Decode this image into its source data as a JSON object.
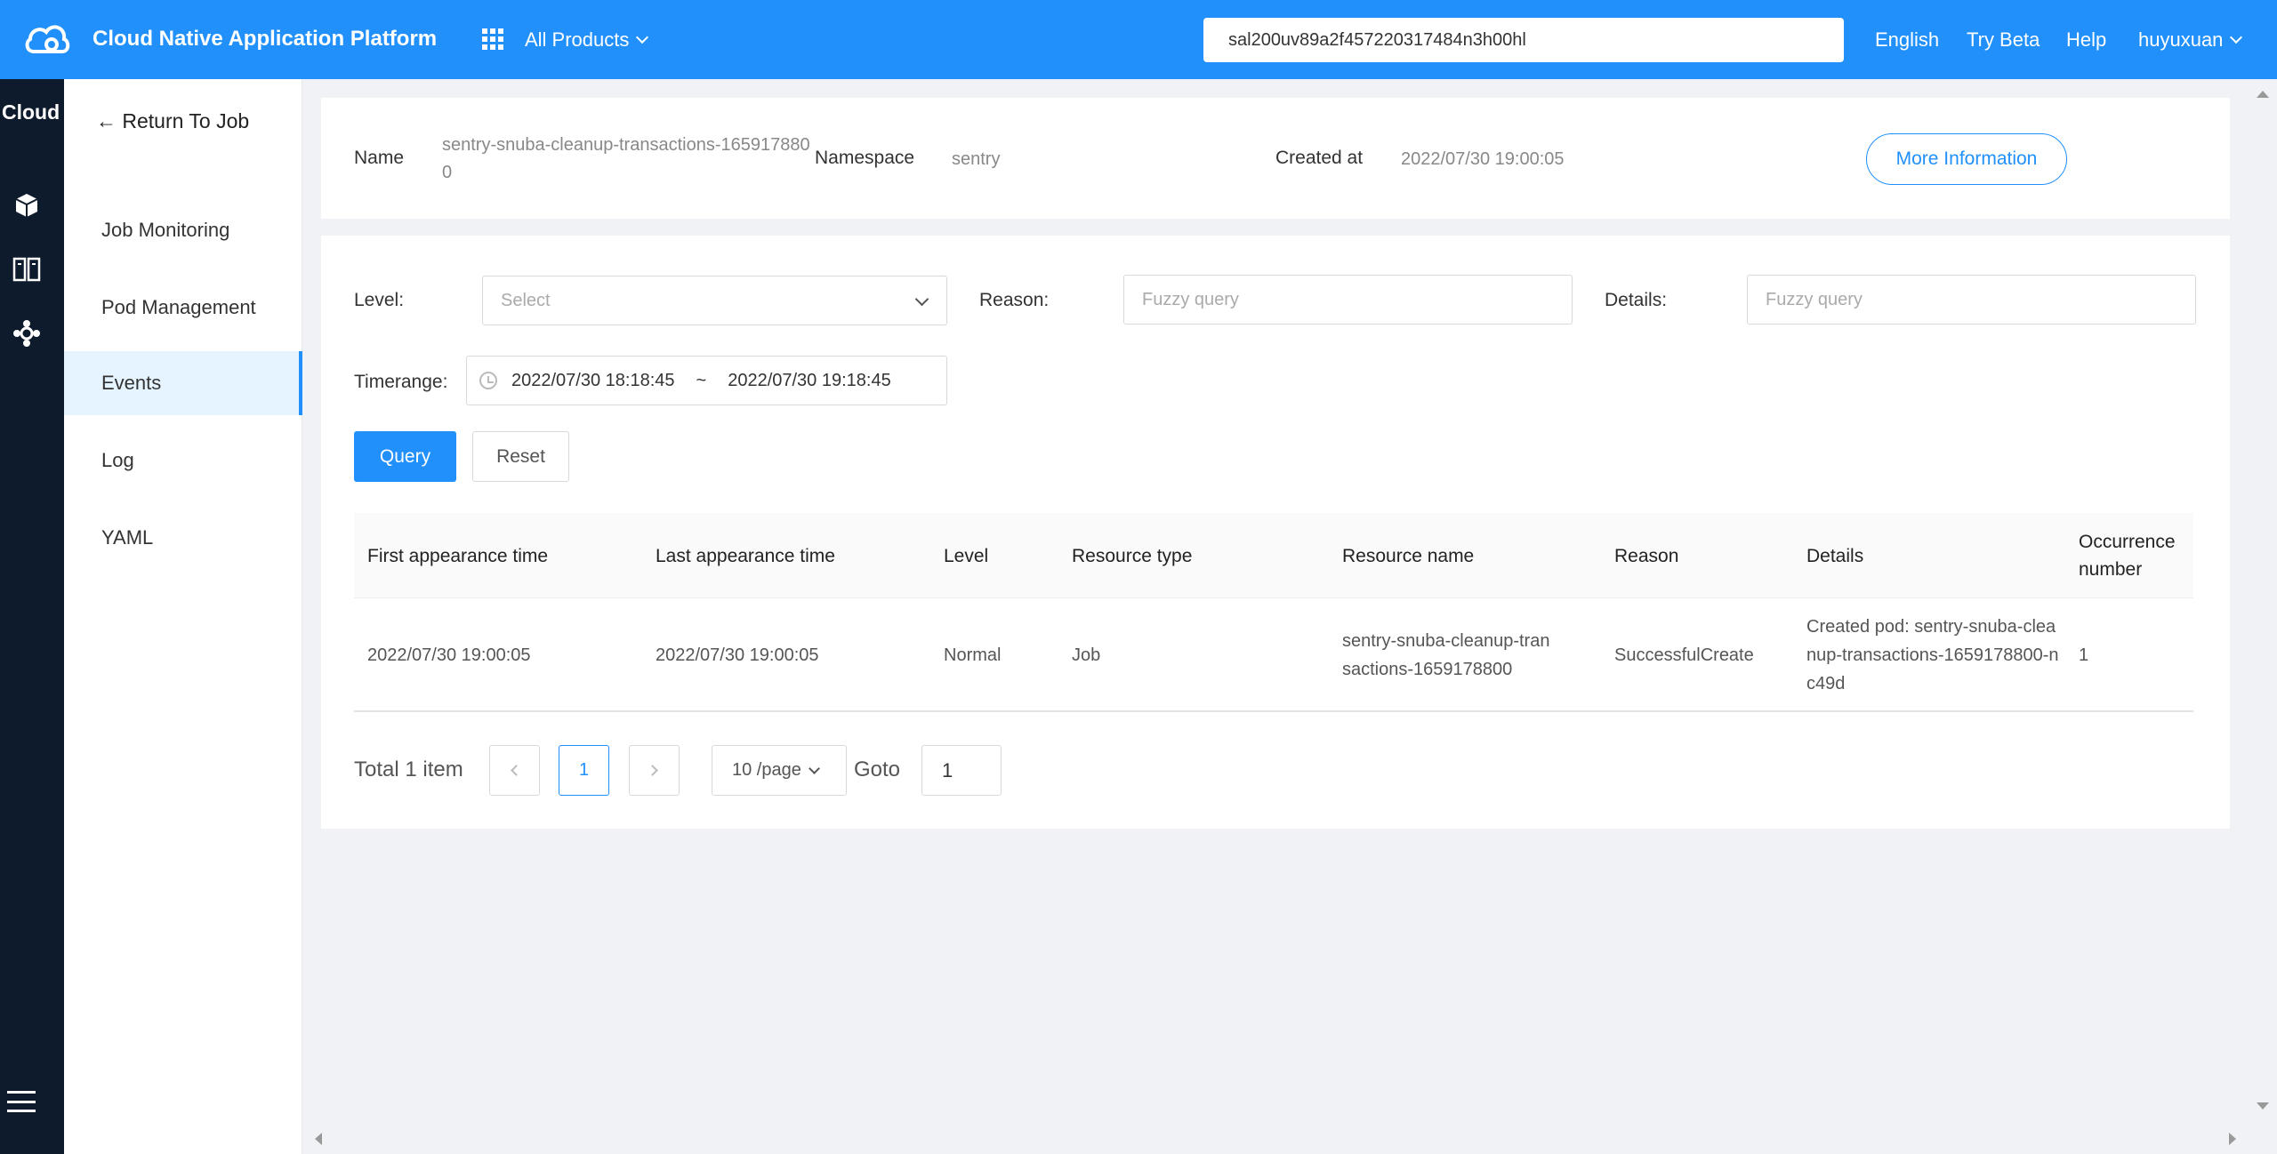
{
  "header": {
    "app_title": "Cloud Native Application Platform",
    "all_products": "All Products",
    "search_value": "sal200uv89a2f457220317484n3h00hl",
    "links": {
      "english": "English",
      "try_beta": "Try Beta",
      "help": "Help",
      "user": "huyuxuan"
    },
    "accent_color": "#2190fb"
  },
  "rail": {
    "title": "Cloud",
    "icons": [
      "cube-icon",
      "columns-icon",
      "network-icon",
      "menu-icon"
    ]
  },
  "subnav": {
    "back": "← Return To Job",
    "items": [
      {
        "label": "Job Monitoring"
      },
      {
        "label": "Pod Management"
      },
      {
        "label": "Events",
        "active": true
      },
      {
        "label": "Log"
      },
      {
        "label": "YAML"
      }
    ]
  },
  "info": {
    "name_label": "Name",
    "name_value": "sentry-snuba-cleanup-transactions-1659178800",
    "namespace_label": "Namespace",
    "namespace_value": "sentry",
    "created_label": "Created at",
    "created_value": "2022/07/30 19:00:05",
    "more_button": "More Information"
  },
  "filters": {
    "level_label": "Level:",
    "level_placeholder": "Select",
    "reason_label": "Reason:",
    "reason_placeholder": "Fuzzy query",
    "details_label": "Details:",
    "details_placeholder": "Fuzzy query",
    "timerange_label": "Timerange:",
    "time_start": "2022/07/30 18:18:45",
    "time_sep": "~",
    "time_end": "2022/07/30 19:18:45",
    "query_button": "Query",
    "reset_button": "Reset"
  },
  "table": {
    "headers": [
      "First appearance time",
      "Last appearance time",
      "Level",
      "Resource type",
      "Resource name",
      "Reason",
      "Details",
      "Occurrence number"
    ],
    "rows": [
      [
        "2022/07/30 19:00:05",
        "2022/07/30 19:00:05",
        "Normal",
        "Job",
        "sentry-snuba-cleanup-transactions-1659178800",
        "SuccessfulCreate",
        "Created pod: sentry-snuba-cleanup-transactions-1659178800-nc49d",
        "1"
      ]
    ]
  },
  "pagination": {
    "total": "Total 1 item",
    "current_page": "1",
    "page_size": "10 /page",
    "goto_label": "Goto",
    "goto_value": "1"
  }
}
